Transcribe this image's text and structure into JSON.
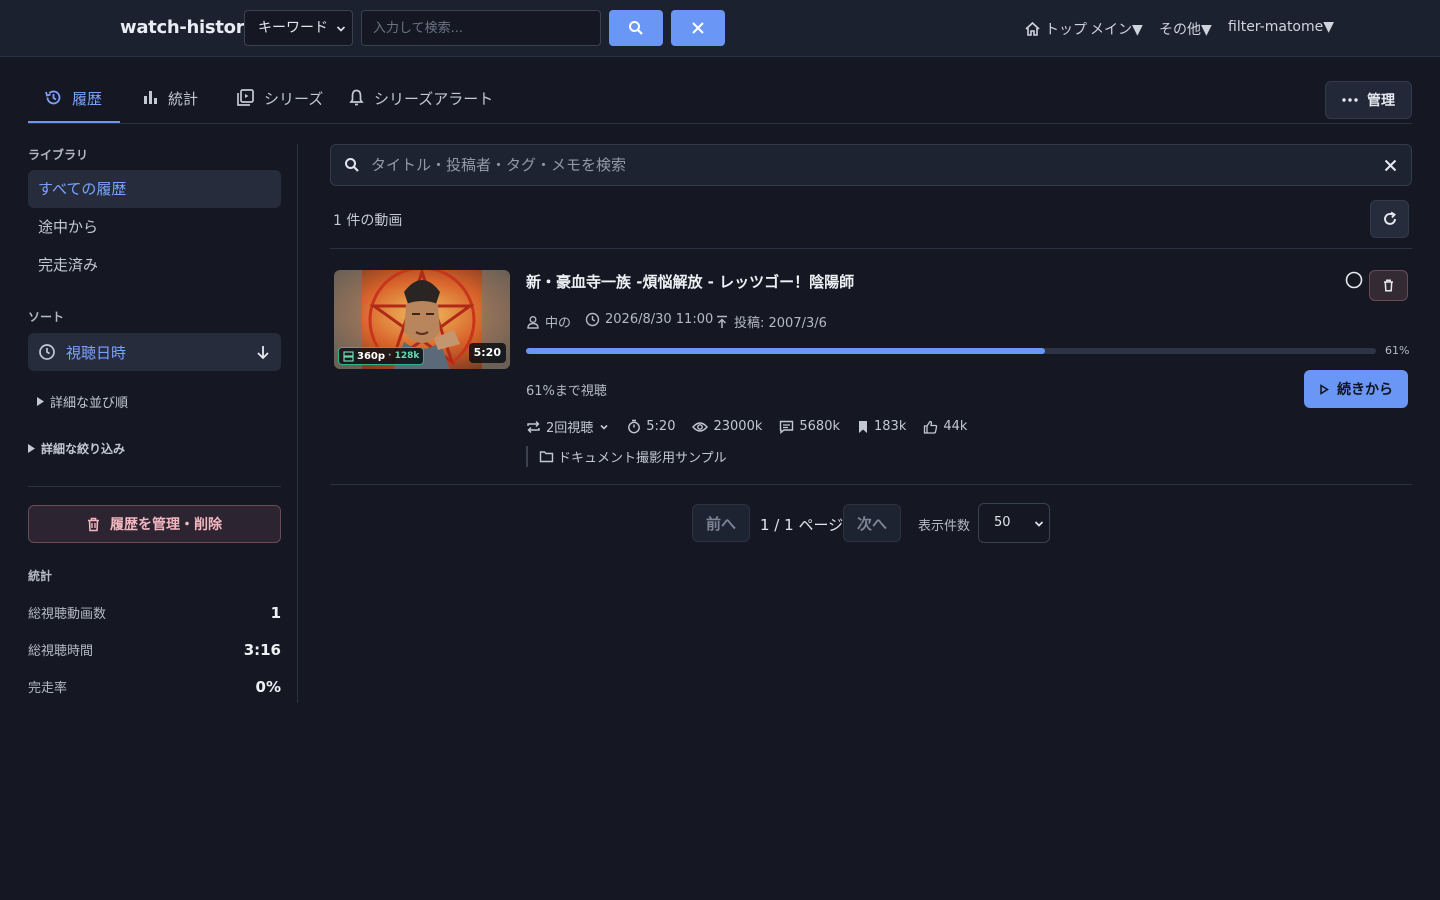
{
  "topbar": {
    "brand": "watch-history",
    "mode_select": "キーワード",
    "search_placeholder": "入力して検索...",
    "nav": [
      {
        "label": "トップ",
        "icon": "home-icon"
      },
      {
        "label": "メイン▼"
      },
      {
        "label": "その他▼"
      },
      {
        "label": "filter-matome▼"
      }
    ]
  },
  "tabs": [
    {
      "label": "履歴",
      "icon": "history-icon",
      "active": true
    },
    {
      "label": "統計",
      "icon": "bar-chart-icon"
    },
    {
      "label": "シリーズ",
      "icon": "collection-icon"
    },
    {
      "label": "シリーズアラート",
      "icon": "bell-icon"
    }
  ],
  "manage_label": "管理",
  "sidebar": {
    "library_heading": "ライブラリ",
    "library_items": [
      "すべての履歴",
      "途中から",
      "完走済み"
    ],
    "sort_heading": "ソート",
    "sort_value": "視聴日時",
    "advanced_sort": "詳細な並び順",
    "advanced_filter": "詳細な絞り込み",
    "manage_delete": "履歴を管理・削除",
    "stats_heading": "統計",
    "stats": [
      {
        "label": "総視聴動画数",
        "value": "1"
      },
      {
        "label": "総視聴時間",
        "value": "3:16"
      },
      {
        "label": "完走率",
        "value": "0%"
      }
    ]
  },
  "main": {
    "search_placeholder": "タイトル・投稿者・タグ・メモを検索",
    "count_text": "1 件の動画",
    "video": {
      "title": "新・豪血寺一族 -煩悩解放 - レッツゴー！陰陽師",
      "quality": "360p",
      "bitrate": "· 128k",
      "duration_badge": "5:20",
      "uploader": "中の",
      "watched_at": "2026/8/30 11:00",
      "posted": "投稿: 2007/3/6",
      "progress": 0.61,
      "progress_label": "61%",
      "watched_to": "61%まで視聴",
      "resume": "続きから",
      "views_count": "2回視聴",
      "length": "5:20",
      "plays": "23000k",
      "comments": "5680k",
      "mylists": "183k",
      "likes": "44k",
      "folder": "ドキュメント撮影用サンプル"
    }
  },
  "pager": {
    "prev": "前へ",
    "page_text": "1 / 1 ページ",
    "next": "次へ",
    "per_page_label": "表示件数",
    "per_page": "50"
  }
}
